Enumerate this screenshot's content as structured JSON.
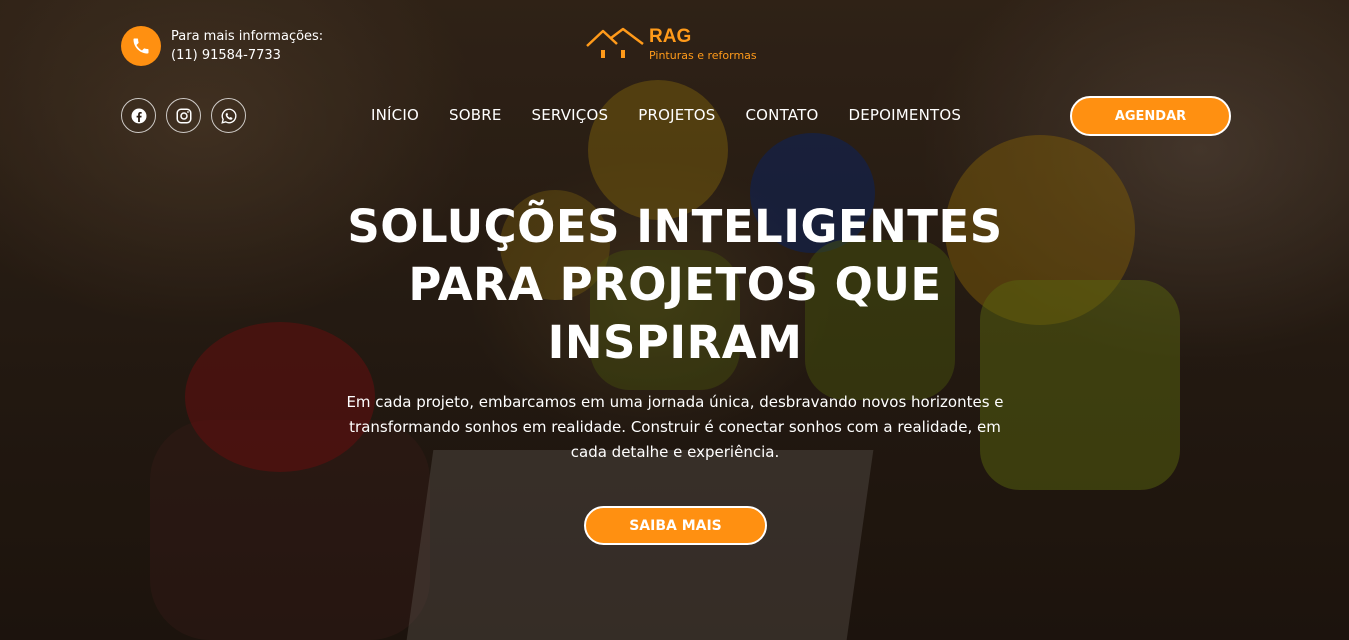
{
  "contact": {
    "label": "Para mais informações:",
    "phone": "(11) 91584-7733",
    "icon": "phone-icon"
  },
  "logo": {
    "name": "RAG",
    "tagline": "Pinturas e reformas",
    "icon": "house-roof-icon"
  },
  "socials": [
    {
      "icon": "facebook-icon"
    },
    {
      "icon": "instagram-icon"
    },
    {
      "icon": "whatsapp-icon"
    }
  ],
  "nav": {
    "items": [
      "INÍCIO",
      "SOBRE",
      "SERVIÇOS",
      "PROJETOS",
      "CONTATO",
      "DEPOIMENTOS"
    ]
  },
  "cta_top": "AGENDAR",
  "hero": {
    "line1": "SOLUÇÕES INTELIGENTES",
    "line2": "PARA PROJETOS QUE",
    "line3": "INSPIRAM",
    "lead1": "Em cada projeto, embarcamos em uma jornada única, desbravando novos horizontes e",
    "lead2": "transformando sonhos em realidade. Construir é conectar sonhos com a realidade, em",
    "lead3": "cada detalhe e experiência.",
    "cta": "SAIBA MAIS"
  },
  "colors": {
    "accent": "#ff9011",
    "text": "#ffffff"
  }
}
